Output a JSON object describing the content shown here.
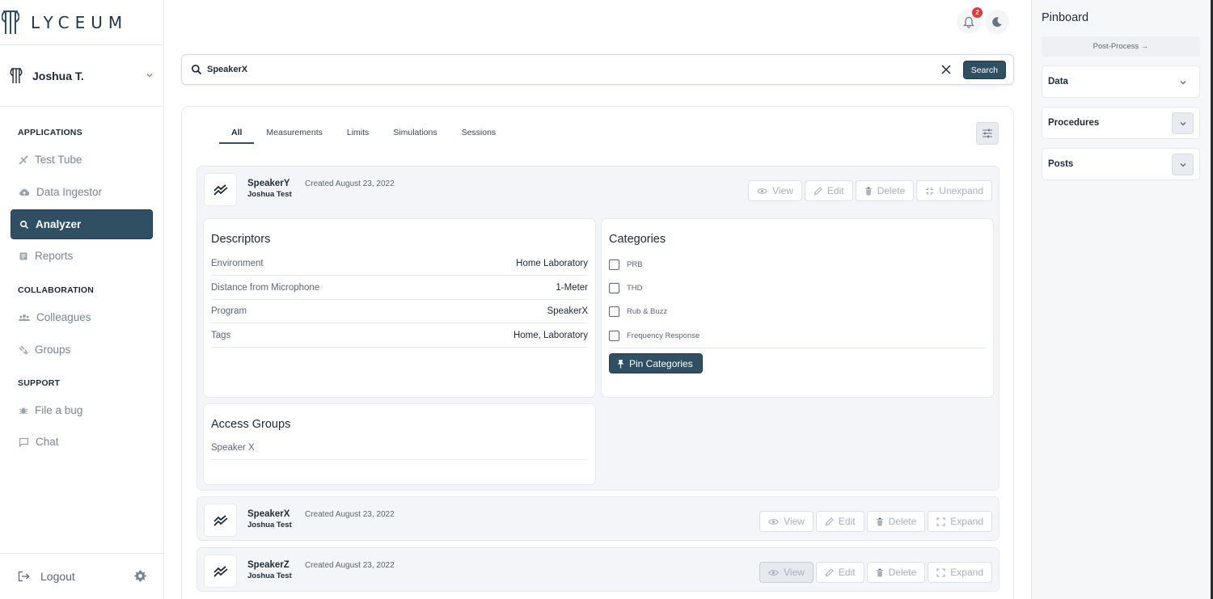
{
  "brand": {
    "name": "LYCEUM"
  },
  "user": {
    "name": "Joshua T."
  },
  "nav": {
    "applications_heading": "APPLICATIONS",
    "collaboration_heading": "COLLABORATION",
    "support_heading": "SUPPORT",
    "test_tube": "Test Tube",
    "data_ingestor": "Data Ingestor",
    "analyzer": "Analyzer",
    "reports": "Reports",
    "colleagues": "Colleagues",
    "groups": "Groups",
    "file_bug": "File a bug",
    "chat": "Chat",
    "logout": "Logout"
  },
  "notifications": {
    "count": "2"
  },
  "search": {
    "value": "SpeakerX",
    "button": "Search"
  },
  "tabs": [
    "All",
    "Measurements",
    "Limits",
    "Simulations",
    "Sessions"
  ],
  "actions": {
    "view": "View",
    "edit": "Edit",
    "delete": "Delete",
    "unexpand": "Unexpand",
    "expand": "Expand"
  },
  "cards": [
    {
      "title": "SpeakerY",
      "author": "Joshua Test",
      "created": "Created August 23, 2022"
    },
    {
      "title": "SpeakerX",
      "author": "Joshua Test",
      "created": "Created August 23, 2022"
    },
    {
      "title": "SpeakerZ",
      "author": "Joshua Test",
      "created": "Created August 23, 2022"
    }
  ],
  "descriptors": {
    "heading": "Descriptors",
    "rows": [
      {
        "key": "Environment",
        "value": "Home Laboratory"
      },
      {
        "key": "Distance from Microphone",
        "value": "1-Meter"
      },
      {
        "key": "Program",
        "value": "SpeakerX"
      },
      {
        "key": "Tags",
        "value": "Home, Laboratory"
      }
    ]
  },
  "categories": {
    "heading": "Categories",
    "items": [
      "PRB",
      "THD",
      "Rub & Buzz",
      "Frequency Response"
    ],
    "pin_button": "Pin Categories"
  },
  "access_groups": {
    "heading": "Access Groups",
    "items": [
      "Speaker X"
    ]
  },
  "pinboard": {
    "title": "Pinboard",
    "post_process": "Post-Process →",
    "sections": [
      "Data",
      "Procedures",
      "Posts"
    ]
  },
  "colors": {
    "accent": "#2f5063",
    "badge": "#e53935"
  }
}
